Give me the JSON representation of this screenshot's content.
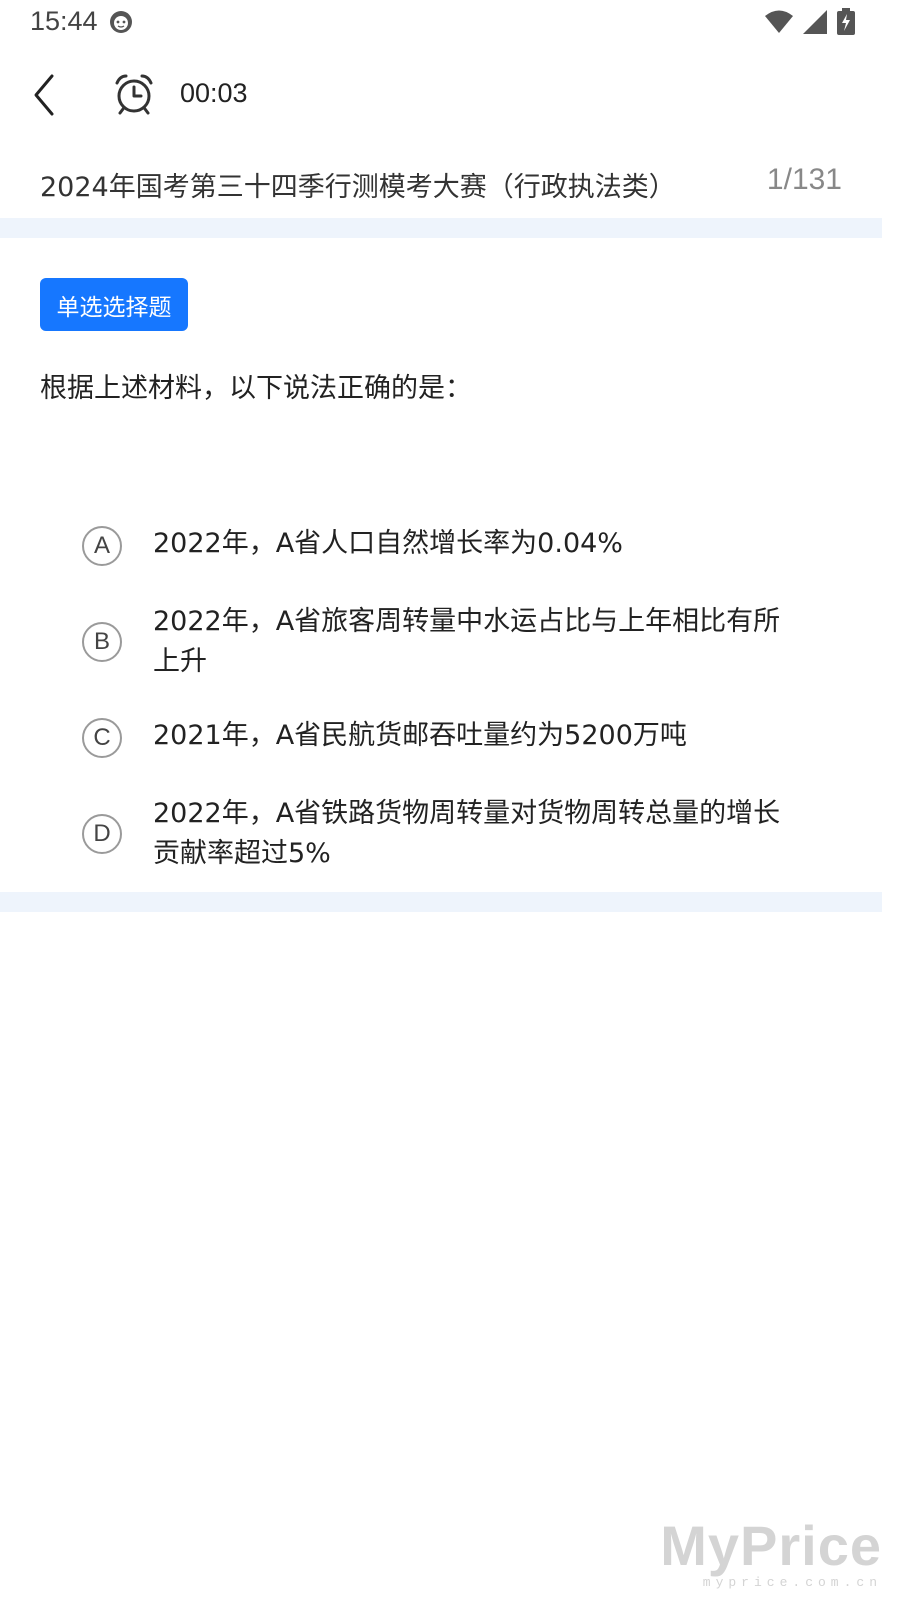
{
  "status_bar": {
    "time": "15:44",
    "icons": [
      "face-icon",
      "wifi-icon",
      "signal-icon",
      "battery-charging-icon"
    ]
  },
  "top_bar": {
    "timer": "00:03",
    "icons": [
      "back-icon",
      "alarm-clock-icon"
    ]
  },
  "exam": {
    "title": "2024年国考第三十四季行测模考大赛（行政执法类）",
    "progress": "1/131"
  },
  "question": {
    "type_badge": "单选选择题",
    "text": "根据上述材料，以下说法正确的是：",
    "options": [
      {
        "letter": "A",
        "text": "2022年，A省人口自然增长率为0.04%"
      },
      {
        "letter": "B",
        "text": "2022年，A省旅客周转量中水运占比与上年相比有所上升"
      },
      {
        "letter": "C",
        "text": "2021年，A省民航货邮吞吐量约为5200万吨"
      },
      {
        "letter": "D",
        "text": "2022年，A省铁路货物周转量对货物周转总量的增长贡献率超过5%"
      }
    ]
  },
  "colors": {
    "accent": "#1677ff",
    "band": "#eef4fc",
    "option_border": "#9a9a9a",
    "muted_text": "#888888"
  },
  "watermark": {
    "main": "MyPrice",
    "sub": "myprice.com.cn"
  }
}
